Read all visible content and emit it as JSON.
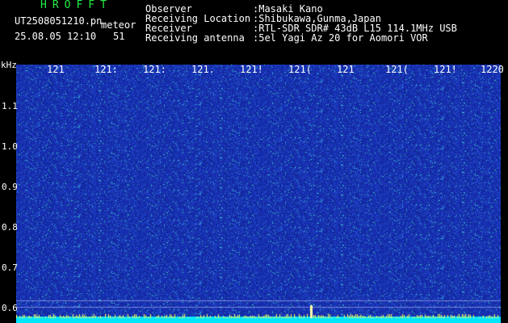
{
  "header": {
    "brand": "HROFFT",
    "filename": "UT2508051210.pn",
    "detection_type": "meteor",
    "datetime": "25.08.05 12:10",
    "count": "51",
    "fields": [
      {
        "label": "Observer",
        "value": ":Masaki Kano"
      },
      {
        "label": "Receiving Location",
        "value": ":Shibukawa,Gunma,Japan"
      },
      {
        "label": "Receiver",
        "value": ":RTL-SDR SDR# 43dB L15 114.1MHz USB"
      },
      {
        "label": "Receiving antenna",
        "value": ":5el Yagi Az 20 for Aomori VOR"
      }
    ]
  },
  "axes": {
    "y_unit": "kHz",
    "y_ticks": [
      "1.1",
      "1.0",
      "0.9",
      "0.8",
      "0.7",
      "0.6"
    ],
    "x_ticks": [
      "121",
      "121:",
      "121:",
      "121.",
      "121!",
      "121(",
      "121",
      "121(",
      "121!",
      "1220"
    ]
  },
  "colors": {
    "background": "#000000",
    "brand": "#22ee44",
    "noise_base": "#1a2f9c",
    "baseline": "#00e5ff"
  }
}
